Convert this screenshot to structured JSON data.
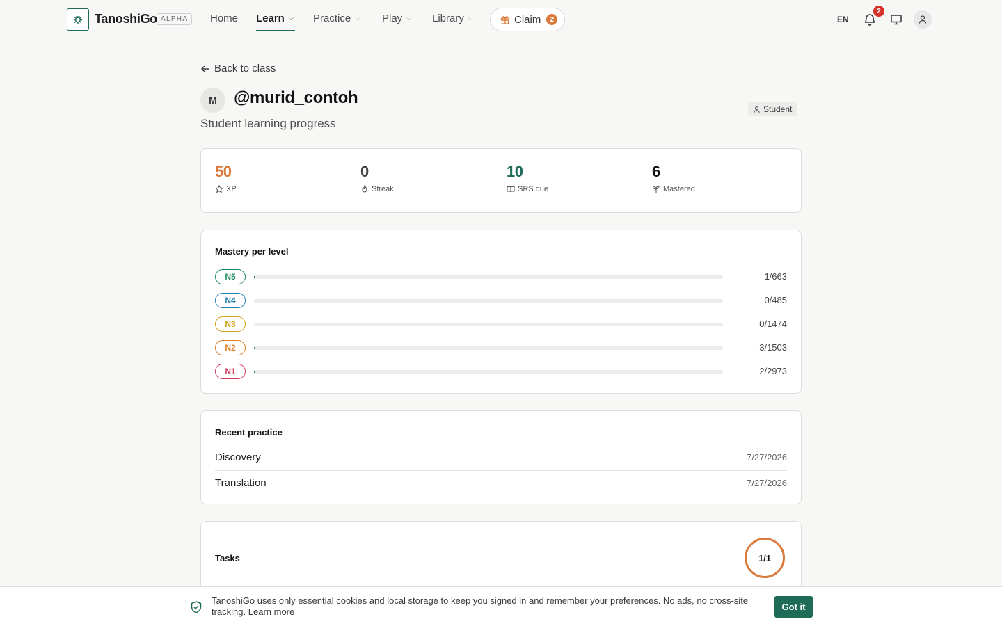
{
  "header": {
    "brand": "TanoshiGo",
    "alpha": "ALPHA",
    "nav": [
      {
        "label": "Home"
      },
      {
        "label": "Learn"
      },
      {
        "label": "Practice"
      },
      {
        "label": "Play"
      },
      {
        "label": "Library"
      }
    ],
    "claim_label": "Claim",
    "claim_count": "2",
    "lang": "EN",
    "notif_count": "2"
  },
  "page": {
    "back_label": "Back to class",
    "avatar_letter": "M",
    "username": "@murid_contoh",
    "subtitle": "Student learning progress",
    "role": "Student"
  },
  "stats": [
    {
      "value": "50",
      "label": "XP",
      "color": "#d9773a",
      "icon": "star-icon"
    },
    {
      "value": "0",
      "label": "Streak",
      "color": "#444444",
      "icon": "flame-icon"
    },
    {
      "value": "10",
      "label": "SRS due",
      "color": "#1e6b57",
      "icon": "book-icon"
    },
    {
      "value": "6",
      "label": "Mastered",
      "color": "#111111",
      "icon": "sprout-icon"
    }
  ],
  "mastery": {
    "title": "Mastery per level",
    "levels": [
      {
        "level": "N5",
        "count": "1/663",
        "fraction": 0.0015,
        "color": "#1e8a5f"
      },
      {
        "level": "N4",
        "count": "0/485",
        "fraction": 0,
        "color": "#1f7fb3"
      },
      {
        "level": "N3",
        "count": "0/1474",
        "fraction": 0,
        "color": "#d4a017"
      },
      {
        "level": "N2",
        "count": "3/1503",
        "fraction": 0.002,
        "color": "#e07b24"
      },
      {
        "level": "N1",
        "count": "2/2973",
        "fraction": 0.0007,
        "color": "#d03b5a"
      }
    ]
  },
  "recent": {
    "title": "Recent practice",
    "items": [
      {
        "name": "Discovery",
        "date": "7/27/2026"
      },
      {
        "name": "Translation",
        "date": "7/27/2026"
      }
    ]
  },
  "tasks": {
    "title": "Tasks",
    "progress": "1/1"
  },
  "cookie": {
    "text": "TanoshiGo uses only essential cookies and local storage to keep you signed in and remember your preferences. No ads, no cross-site tracking.",
    "link": "Learn more",
    "button": "Got it"
  }
}
